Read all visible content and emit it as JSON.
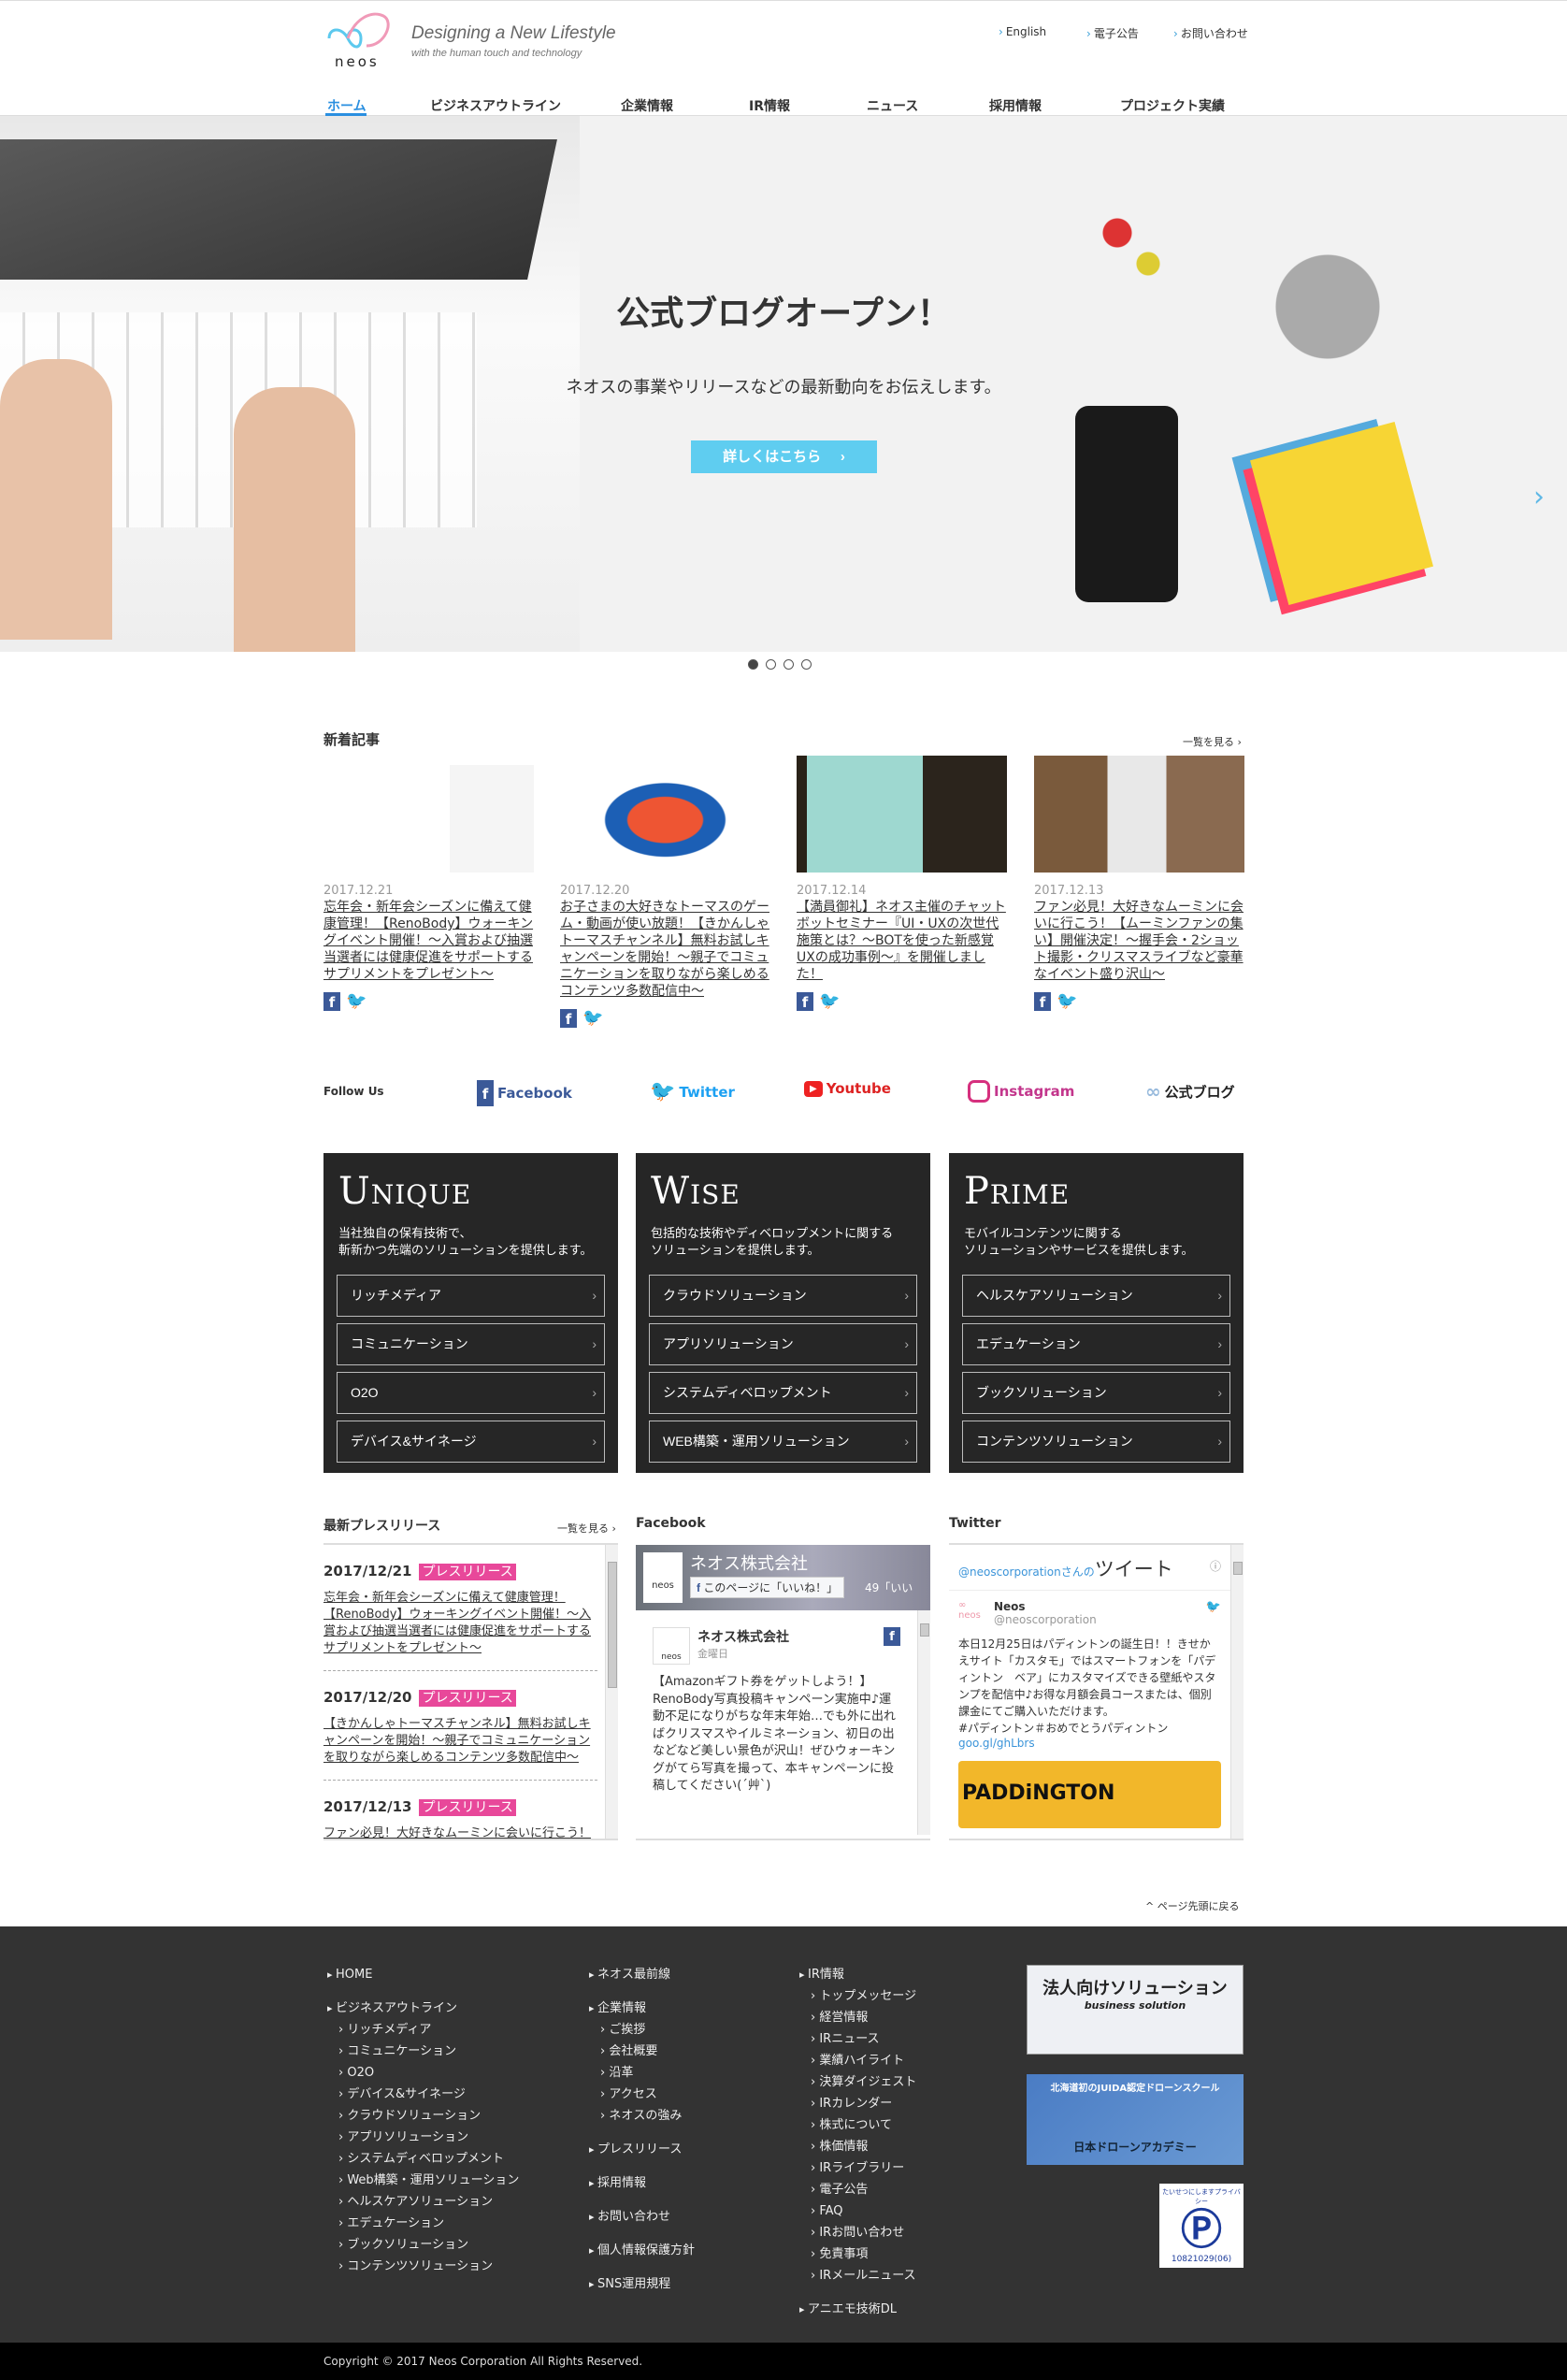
{
  "header": {
    "tagline": "Designing a New Lifestyle",
    "tagline_sub": "with the human touch and technology",
    "logo_text": "neos",
    "util_links": [
      "English",
      "電子公告",
      "お問い合わせ"
    ],
    "nav": [
      "ホーム",
      "ビジネスアウトライン",
      "企業情報",
      "IR情報",
      "ニュース",
      "採用情報",
      "プロジェクト実績"
    ]
  },
  "hero": {
    "title": "公式ブログオープン！",
    "subtitle": "ネオスの事業やリリースなどの最新動向をお伝えします。",
    "button": "詳しくはこちら",
    "slides": 4,
    "active_slide": 1
  },
  "news": {
    "title": "新着記事",
    "more": "一覧を見る",
    "items": [
      {
        "date": "2017.12.21",
        "text": "忘年会・新年会シーズンに備えて健康管理！【RenoBody】ウォーキングイベント開催！～入賞および抽選当選者には健康促進をサポートするサプリメントをプレゼント～"
      },
      {
        "date": "2017.12.20",
        "text": "お子さまの大好きなトーマスのゲーム・動画が使い放題！【きかんしゃトーマスチャンネル】無料お試しキャンペーンを開始！～親子でコミュニケーションを取りながら楽しめるコンテンツ多数配信中～"
      },
      {
        "date": "2017.12.14",
        "text": "【満員御礼】ネオス主催のチャットボットセミナー『UI・UXの次世代施策とは？～BOTを使った新感覚UXの成功事例～』を開催しました！"
      },
      {
        "date": "2017.12.13",
        "text": "ファン必見！大好きなムーミンに会いに行こう！【ムーミンファンの集い】開催決定！～握手会・2ショット撮影・クリスマスライブなど豪華なイベント盛り沢山～"
      }
    ]
  },
  "follow": {
    "label": "Follow Us",
    "links": [
      "Facebook",
      "Twitter",
      "Youtube",
      "Instagram",
      "公式ブログ"
    ]
  },
  "panels": [
    {
      "title": "Unique",
      "desc1": "当社独自の保有技術で、",
      "desc2": "斬新かつ先端のソリューションを提供します。",
      "items": [
        "リッチメディア",
        "コミュニケーション",
        "O2O",
        "デバイス&サイネージ"
      ]
    },
    {
      "title": "Wise",
      "desc1": "包括的な技術やディベロップメントに関する",
      "desc2": "ソリューションを提供します。",
      "items": [
        "クラウドソリューション",
        "アプリソリューション",
        "システムディベロップメント",
        "WEB構築・運用ソリューション"
      ]
    },
    {
      "title": "Prime",
      "desc1": "モバイルコンテンツに関する",
      "desc2": "ソリューションやサービスを提供します。",
      "items": [
        "ヘルスケアソリューション",
        "エデュケーション",
        "ブックソリューション",
        "コンテンツソリューション"
      ]
    }
  ],
  "press": {
    "title": "最新プレスリリース",
    "more": "一覧を見る",
    "items": [
      {
        "date": "2017/12/21",
        "badge": "プレスリリース",
        "text": "忘年会・新年会シーズンに備えて健康管理！【RenoBody】ウォーキングイベント開催！～入賞および抽選当選者には健康促進をサポートするサプリメントをプレゼント～"
      },
      {
        "date": "2017/12/20",
        "badge": "プレスリリース",
        "text": "【きかんしゃトーマスチャンネル】無料お試しキャンペーンを開始！～親子でコミュニケーションを取りながら楽しめるコンテンツ多数配信中～"
      },
      {
        "date": "2017/12/13",
        "badge": "プレスリリース",
        "text": "ファン必見！大好きなムーミンに会いに行こう！"
      }
    ]
  },
  "facebook": {
    "title": "Facebook",
    "page_name": "ネオス株式会社",
    "like_button": "このページに「いいね！」",
    "like_count": "49「いい",
    "post_author": "ネオス株式会社",
    "post_time": "金曜日",
    "post_text": "【Amazonギフト券をゲットしよう！】RenoBody写真投稿キャンペーン実施中♪運動不足になりがちな年末年始…でも外に出ればクリスマスやイルミネーション、初日の出などなど美しい景色が沢山！ぜひウォーキングがてら写真を撮って、本キャンペーンに投稿してください(´艸`)"
  },
  "twitter": {
    "title": "Twitter",
    "handle_header": "@neoscorporation",
    "header_suffix": "さんの",
    "header_big": "ツイート",
    "name": "Neos",
    "handle": "@neoscorporation",
    "text": "本日12月25日はパディントンの誕生日！！きせかえサイト「カスタモ」ではスマートフォンを「パディントン　ベア」にカスタマイズできる壁紙やスタンプを配信中♪お得な月額会員コースまたは、個別課金にてご購入いただけます。",
    "hashtags": "#パディントン＃おめでとうパディントン",
    "link": "goo.gl/ghLbrs",
    "image_text": "PADDiNGTON"
  },
  "page_top": "ページ先頭に戻る",
  "footer": {
    "col1": [
      {
        "t": "HOME",
        "top": true
      },
      {
        "gap": true
      },
      {
        "t": "ビジネスアウトライン",
        "top": true
      },
      {
        "t": "リッチメディア"
      },
      {
        "t": "コミュニケーション"
      },
      {
        "t": "O2O"
      },
      {
        "t": "デバイス&サイネージ"
      },
      {
        "t": "クラウドソリューション"
      },
      {
        "t": "アプリソリューション"
      },
      {
        "t": "システムディベロップメント"
      },
      {
        "t": "Web構築・運用ソリューション"
      },
      {
        "t": "ヘルスケアソリューション"
      },
      {
        "t": "エデュケーション"
      },
      {
        "t": "ブックソリューション"
      },
      {
        "t": "コンテンツソリューション"
      }
    ],
    "col2": [
      {
        "t": "ネオス最前線",
        "top": true
      },
      {
        "gap": true
      },
      {
        "t": "企業情報",
        "top": true
      },
      {
        "t": "ご挨拶"
      },
      {
        "t": "会社概要"
      },
      {
        "t": "沿革"
      },
      {
        "t": "アクセス"
      },
      {
        "t": "ネオスの強み"
      },
      {
        "gap": true
      },
      {
        "t": "プレスリリース",
        "top": true
      },
      {
        "gap": true
      },
      {
        "t": "採用情報",
        "top": true
      },
      {
        "gap": true
      },
      {
        "t": "お問い合わせ",
        "top": true
      },
      {
        "gap": true
      },
      {
        "t": "個人情報保護方針",
        "top": true
      },
      {
        "gap": true
      },
      {
        "t": "SNS運用規程",
        "top": true
      }
    ],
    "col3": [
      {
        "t": "IR情報",
        "top": true
      },
      {
        "t": "トップメッセージ"
      },
      {
        "t": "経営情報"
      },
      {
        "t": "IRニュース"
      },
      {
        "t": "業績ハイライト"
      },
      {
        "t": "決算ダイジェスト"
      },
      {
        "t": "IRカレンダー"
      },
      {
        "t": "株式について"
      },
      {
        "t": "株価情報"
      },
      {
        "t": "IRライブラリー"
      },
      {
        "t": "電子公告"
      },
      {
        "t": "FAQ"
      },
      {
        "t": "IRお問い合わせ"
      },
      {
        "t": "免責事項"
      },
      {
        "t": "IRメールニュース"
      },
      {
        "gap": true
      },
      {
        "t": "アニエモ技術DL",
        "top": true
      }
    ],
    "banner1_title": "法人向けソリューション",
    "banner1_sub": "business solution",
    "banner2_title": "北海道初のJUIDA認定ドローンスクール",
    "banner2_sub": "日本ドローンアカデミー",
    "privacy_mark": "たいせつにしますプライバシー",
    "privacy_number": "10821029(06)",
    "copyright": "Copyright © 2017 Neos Corporation All Rights Reserved."
  },
  "colors": {
    "accent": "#2a8fe0",
    "hero_button": "#5fcdf0",
    "badge": "#e8489a",
    "panel": "#262626",
    "footer": "#333333"
  }
}
